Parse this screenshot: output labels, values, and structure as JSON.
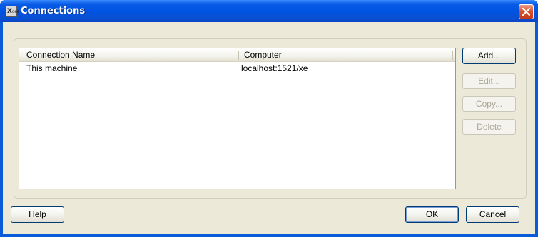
{
  "window": {
    "title": "Connections",
    "icon_text": "X",
    "icon_sub": "ora"
  },
  "connections_table": {
    "columns": [
      "Connection Name",
      "Computer"
    ],
    "rows": [
      {
        "name": "This machine",
        "computer": "localhost:1521/xe"
      }
    ]
  },
  "side_buttons": {
    "add": "Add...",
    "edit": "Edit...",
    "copy": "Copy...",
    "delete": "Delete"
  },
  "footer_buttons": {
    "help": "Help",
    "ok": "OK",
    "cancel": "Cancel"
  },
  "colors": {
    "titlebar": "#0054e3",
    "dialog_bg": "#ece9d8",
    "close_button": "#d8542f"
  }
}
